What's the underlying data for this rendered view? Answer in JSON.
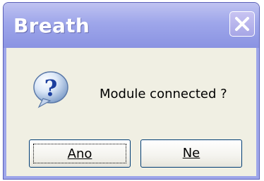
{
  "dialog": {
    "title": "Breath",
    "message": "Module connected ?",
    "icon": "question-icon",
    "close_icon": "close-icon"
  },
  "buttons": {
    "yes_label": "Ano",
    "no_label": "Ne"
  },
  "colors": {
    "titlebar": "#9ea6ea",
    "client_bg": "#f0efe3",
    "button_border": "#003c74"
  }
}
